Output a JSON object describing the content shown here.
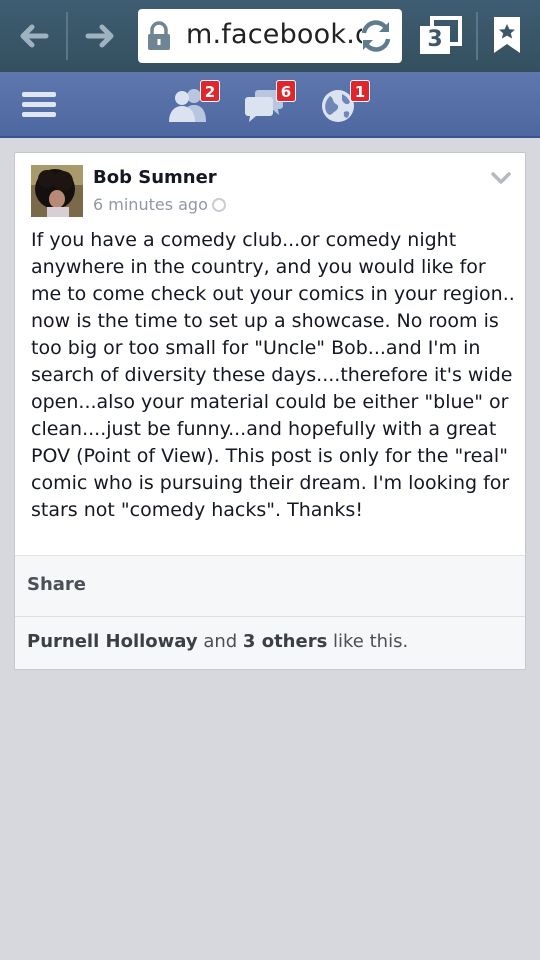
{
  "browser": {
    "url": "m.facebook.com",
    "tab_count": "3",
    "icons": [
      "back-arrow-icon",
      "forward-arrow-icon",
      "lock-icon",
      "refresh-icon",
      "tabs-icon",
      "bookmark-icon"
    ]
  },
  "fb_header": {
    "friend_requests_count": "2",
    "messages_count": "6",
    "notifications_count": "1",
    "colors": {
      "bar": "#5d77ad",
      "badge": "#e0262a"
    }
  },
  "post": {
    "author": "Bob Sumner",
    "timestamp": "6 minutes ago",
    "body": "If you have a comedy club...or comedy night anywhere in the country, and you would like for me to come check out your comics in your region.. now is the time to set up a showcase. No room is too big or too small for \"Uncle\" Bob...and I'm in search of diversity these days....therefore it's wide open...also your material could be either \"blue\" or clean....just be funny...and hopefully with a great POV (Point of View). This post is only for the \"real\" comic who is pursuing their dream. I'm looking for stars not \"comedy hacks\". Thanks!",
    "share_label": "Share",
    "likes": {
      "liker": "Purnell Holloway",
      "connector": " and ",
      "others": "3 others",
      "suffix": " like this."
    }
  }
}
